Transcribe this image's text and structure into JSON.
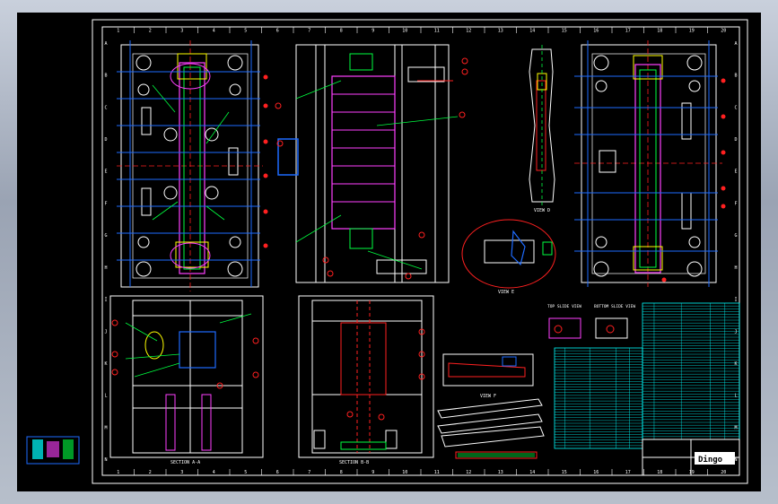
{
  "drawing": {
    "column_numbers": [
      "1",
      "2",
      "3",
      "4",
      "5",
      "6",
      "7",
      "8",
      "9",
      "10",
      "11",
      "12",
      "13",
      "14",
      "15",
      "16",
      "17",
      "18",
      "19",
      "20"
    ],
    "row_letters": [
      "A",
      "B",
      "C",
      "D",
      "E",
      "F",
      "G",
      "H",
      "I",
      "J",
      "K",
      "L",
      "M",
      "N"
    ],
    "views": {
      "section_aa": "SECTION A-A",
      "section_bb": "SECTION B-B",
      "view_d": "VIEW D",
      "view_e": "VIEW E",
      "view_f": "VIEW F",
      "top_slide_view": "TOP SLIDE VIEW",
      "bottom_slide_view": "BOTTOM SLIDE VIEW"
    },
    "title_block": {
      "company": "Dingo"
    }
  },
  "colors": {
    "sheet_bg": "#000000",
    "frame": "#ffffff",
    "red": "#ff2020",
    "green": "#00ff40",
    "blue": "#1e6bff",
    "magenta": "#ff40ff",
    "cyan": "#00ffff",
    "yellow": "#ffff00"
  }
}
